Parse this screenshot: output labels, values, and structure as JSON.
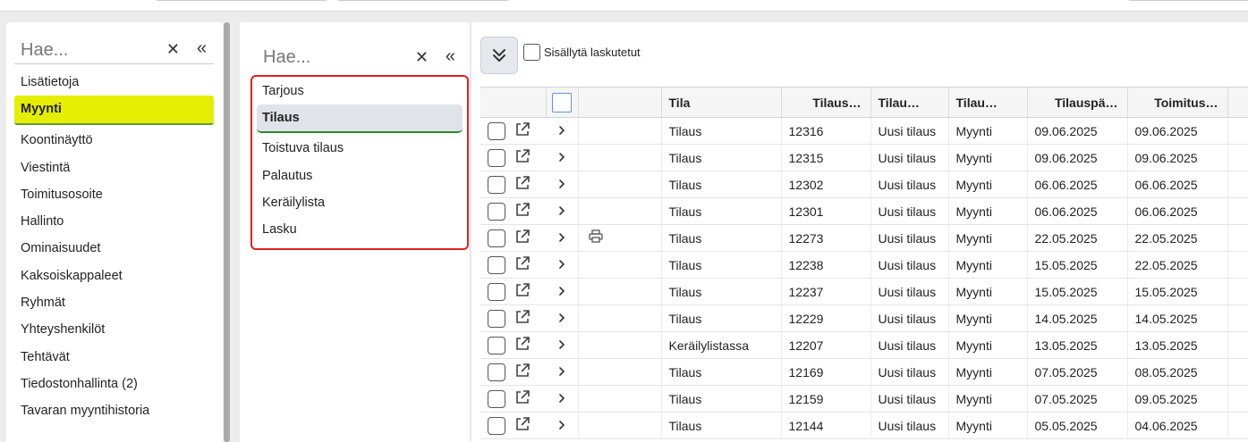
{
  "left_nav": {
    "search_placeholder": "Hae...",
    "items": [
      {
        "label": "Lisätietoja",
        "active": false
      },
      {
        "label": "Myynti",
        "active": true
      },
      {
        "label": "Koontinäyttö",
        "active": false
      },
      {
        "label": "Viestintä",
        "active": false
      },
      {
        "label": "Toimitusosoite",
        "active": false
      },
      {
        "label": "Hallinto",
        "active": false
      },
      {
        "label": "Ominaisuudet",
        "active": false
      },
      {
        "label": "Kaksoiskappaleet",
        "active": false
      },
      {
        "label": "Ryhmät",
        "active": false
      },
      {
        "label": "Yhteyshenkilöt",
        "active": false
      },
      {
        "label": "Tehtävät",
        "active": false
      },
      {
        "label": "Tiedostonhallinta (2)",
        "active": false
      },
      {
        "label": "Tavaran myyntihistoria",
        "active": false
      }
    ]
  },
  "doc_types": {
    "search_placeholder": "Hae...",
    "items": [
      {
        "label": "Tarjous",
        "active": false
      },
      {
        "label": "Tilaus",
        "active": true
      },
      {
        "label": "Toistuva tilaus",
        "active": false
      },
      {
        "label": "Palautus",
        "active": false
      },
      {
        "label": "Keräilylista",
        "active": false
      },
      {
        "label": "Lasku",
        "active": false
      }
    ]
  },
  "toolbar": {
    "include_invoiced_label": "Sisällytä laskutetut"
  },
  "grid": {
    "columns": [
      "Tila",
      "Tilaus…",
      "Tilau…",
      "Tilau…",
      "Tilauspä…",
      "Toimitus…"
    ],
    "rows": [
      {
        "print": false,
        "tila": "Tilaus",
        "no": "12316",
        "status": "Uusi tilaus",
        "type": "Myynti",
        "order_date": "09.06.2025",
        "delivery": "09.06.2025"
      },
      {
        "print": false,
        "tila": "Tilaus",
        "no": "12315",
        "status": "Uusi tilaus",
        "type": "Myynti",
        "order_date": "09.06.2025",
        "delivery": "09.06.2025"
      },
      {
        "print": false,
        "tila": "Tilaus",
        "no": "12302",
        "status": "Uusi tilaus",
        "type": "Myynti",
        "order_date": "06.06.2025",
        "delivery": "06.06.2025"
      },
      {
        "print": false,
        "tila": "Tilaus",
        "no": "12301",
        "status": "Uusi tilaus",
        "type": "Myynti",
        "order_date": "06.06.2025",
        "delivery": "06.06.2025"
      },
      {
        "print": true,
        "tila": "Tilaus",
        "no": "12273",
        "status": "Uusi tilaus",
        "type": "Myynti",
        "order_date": "22.05.2025",
        "delivery": "22.05.2025"
      },
      {
        "print": false,
        "tila": "Tilaus",
        "no": "12238",
        "status": "Uusi tilaus",
        "type": "Myynti",
        "order_date": "15.05.2025",
        "delivery": "22.05.2025"
      },
      {
        "print": false,
        "tila": "Tilaus",
        "no": "12237",
        "status": "Uusi tilaus",
        "type": "Myynti",
        "order_date": "15.05.2025",
        "delivery": "15.05.2025"
      },
      {
        "print": false,
        "tila": "Tilaus",
        "no": "12229",
        "status": "Uusi tilaus",
        "type": "Myynti",
        "order_date": "14.05.2025",
        "delivery": "14.05.2025"
      },
      {
        "print": false,
        "tila": "Keräilylistassa",
        "no": "12207",
        "status": "Uusi tilaus",
        "type": "Myynti",
        "order_date": "13.05.2025",
        "delivery": "13.05.2025"
      },
      {
        "print": false,
        "tila": "Tilaus",
        "no": "12169",
        "status": "Uusi tilaus",
        "type": "Myynti",
        "order_date": "07.05.2025",
        "delivery": "08.05.2025"
      },
      {
        "print": false,
        "tila": "Tilaus",
        "no": "12159",
        "status": "Uusi tilaus",
        "type": "Myynti",
        "order_date": "07.05.2025",
        "delivery": "09.05.2025"
      },
      {
        "print": false,
        "tila": "Tilaus",
        "no": "12144",
        "status": "Uusi tilaus",
        "type": "Myynti",
        "order_date": "05.05.2025",
        "delivery": "04.06.2025"
      }
    ]
  },
  "icons": {
    "clear": "close-icon",
    "collapse": "double-chevron-left-icon",
    "expand": "double-chevron-down-icon",
    "open": "external-link-icon",
    "row_expand": "chevron-right-icon",
    "print": "printer-icon"
  },
  "colors": {
    "active_nav": "#e5ed00",
    "highlight_border": "#e02020",
    "active_underline": "#2e8b2e"
  }
}
